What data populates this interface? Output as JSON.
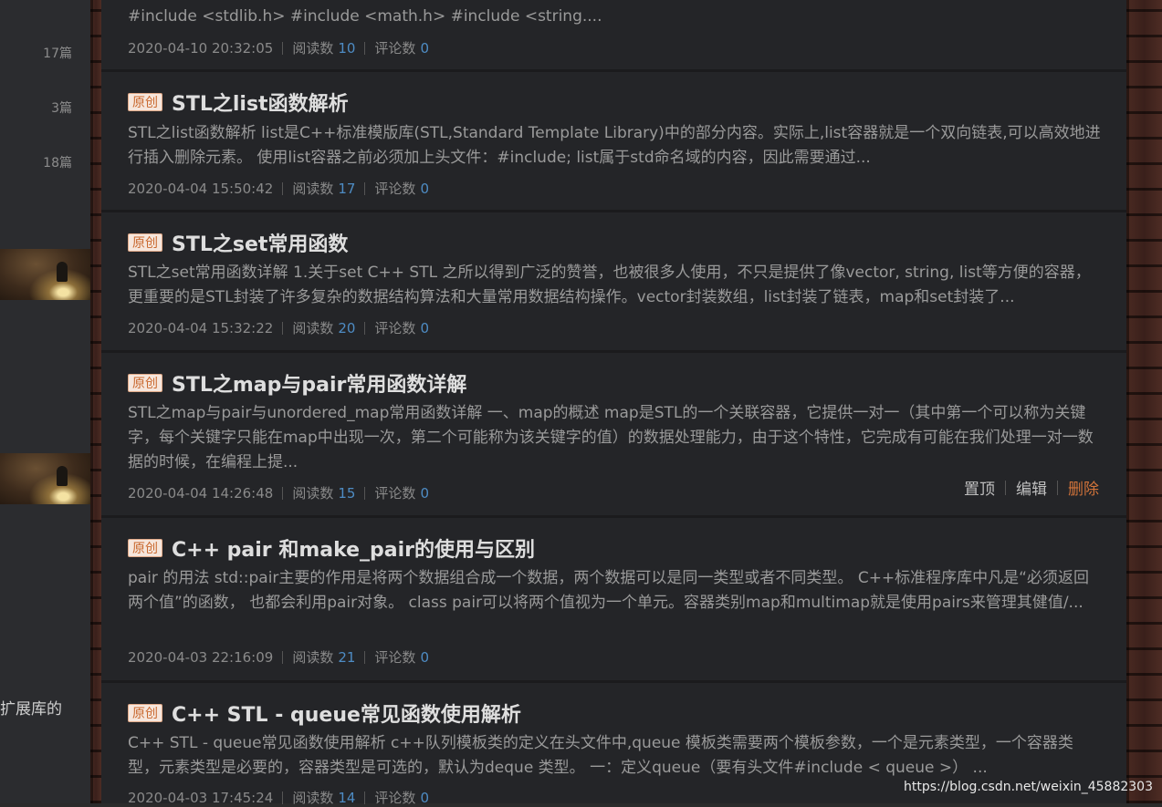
{
  "sidebar": {
    "counts": [
      "17篇",
      "3篇",
      "18篇"
    ],
    "partial_text": "扩展库的"
  },
  "articles": [
    {
      "badge": "",
      "title": "",
      "desc": "#include <stdlib.h> #include <math.h> #include <string....",
      "date": "2020-04-10 20:32:05",
      "read_label": "阅读数",
      "read_count": "10",
      "comment_label": "评论数",
      "comment_count": "0"
    },
    {
      "badge": "原创",
      "title": "STL之list函数解析",
      "desc": "STL之list函数解析 list是C++标准模版库(STL,Standard Template Library)中的部分内容。实际上,list容器就是一个双向链表,可以高效地进行插入删除元素。 使用list容器之前必须加上头文件：#include; list属于std命名域的内容，因此需要通过...",
      "date": "2020-04-04 15:50:42",
      "read_label": "阅读数",
      "read_count": "17",
      "comment_label": "评论数",
      "comment_count": "0"
    },
    {
      "badge": "原创",
      "title": "STL之set常用函数",
      "desc": "STL之set常用函数详解 1.关于set C++ STL 之所以得到广泛的赞誉，也被很多人使用，不只是提供了像vector, string, list等方便的容器，更重要的是STL封装了许多复杂的数据结构算法和大量常用数据结构操作。vector封装数组，list封装了链表，map和set封装了...",
      "date": "2020-04-04 15:32:22",
      "read_label": "阅读数",
      "read_count": "20",
      "comment_label": "评论数",
      "comment_count": "0"
    },
    {
      "badge": "原创",
      "title": "STL之map与pair常用函数详解",
      "desc": "STL之map与pair与unordered_map常用函数详解 一、map的概述 map是STL的一个关联容器，它提供一对一（其中第一个可以称为关键字，每个关键字只能在map中出现一次，第二个可能称为该关键字的值）的数据处理能力，由于这个特性，它完成有可能在我们处理一对一数据的时候，在编程上提...",
      "date": "2020-04-04 14:26:48",
      "read_label": "阅读数",
      "read_count": "15",
      "comment_label": "评论数",
      "comment_count": "0",
      "actions": {
        "pin": "置顶",
        "edit": "编辑",
        "delete": "删除"
      }
    },
    {
      "badge": "原创",
      "title": "C++ pair 和make_pair的使用与区别",
      "desc": "pair 的用法 std::pair主要的作用是将两个数据组合成一个数据，两个数据可以是同一类型或者不同类型。 C++标准程序库中凡是“必须返回两个值”的函数， 也都会利用pair对象。 class pair可以将两个值视为一个单元。容器类别map和multimap就是使用pairs来管理其健值/...",
      "date": "2020-04-03 22:16:09",
      "read_label": "阅读数",
      "read_count": "21",
      "comment_label": "评论数",
      "comment_count": "0"
    },
    {
      "badge": "原创",
      "title": "C++ STL - queue常见函数使用解析",
      "desc": "C++ STL - queue常见函数使用解析 c++队列模板类的定义在头文件中,queue 模板类需要两个模板参数，一个是元素类型，一个容器类型，元素类型是必要的，容器类型是可选的，默认为deque 类型。 一：定义queue（要有头文件#include < queue >） ...",
      "date": "2020-04-03 17:45:24",
      "read_label": "阅读数",
      "read_count": "14",
      "comment_label": "评论数",
      "comment_count": "0"
    }
  ],
  "watermark": "https://blog.csdn.net/weixin_45882303"
}
